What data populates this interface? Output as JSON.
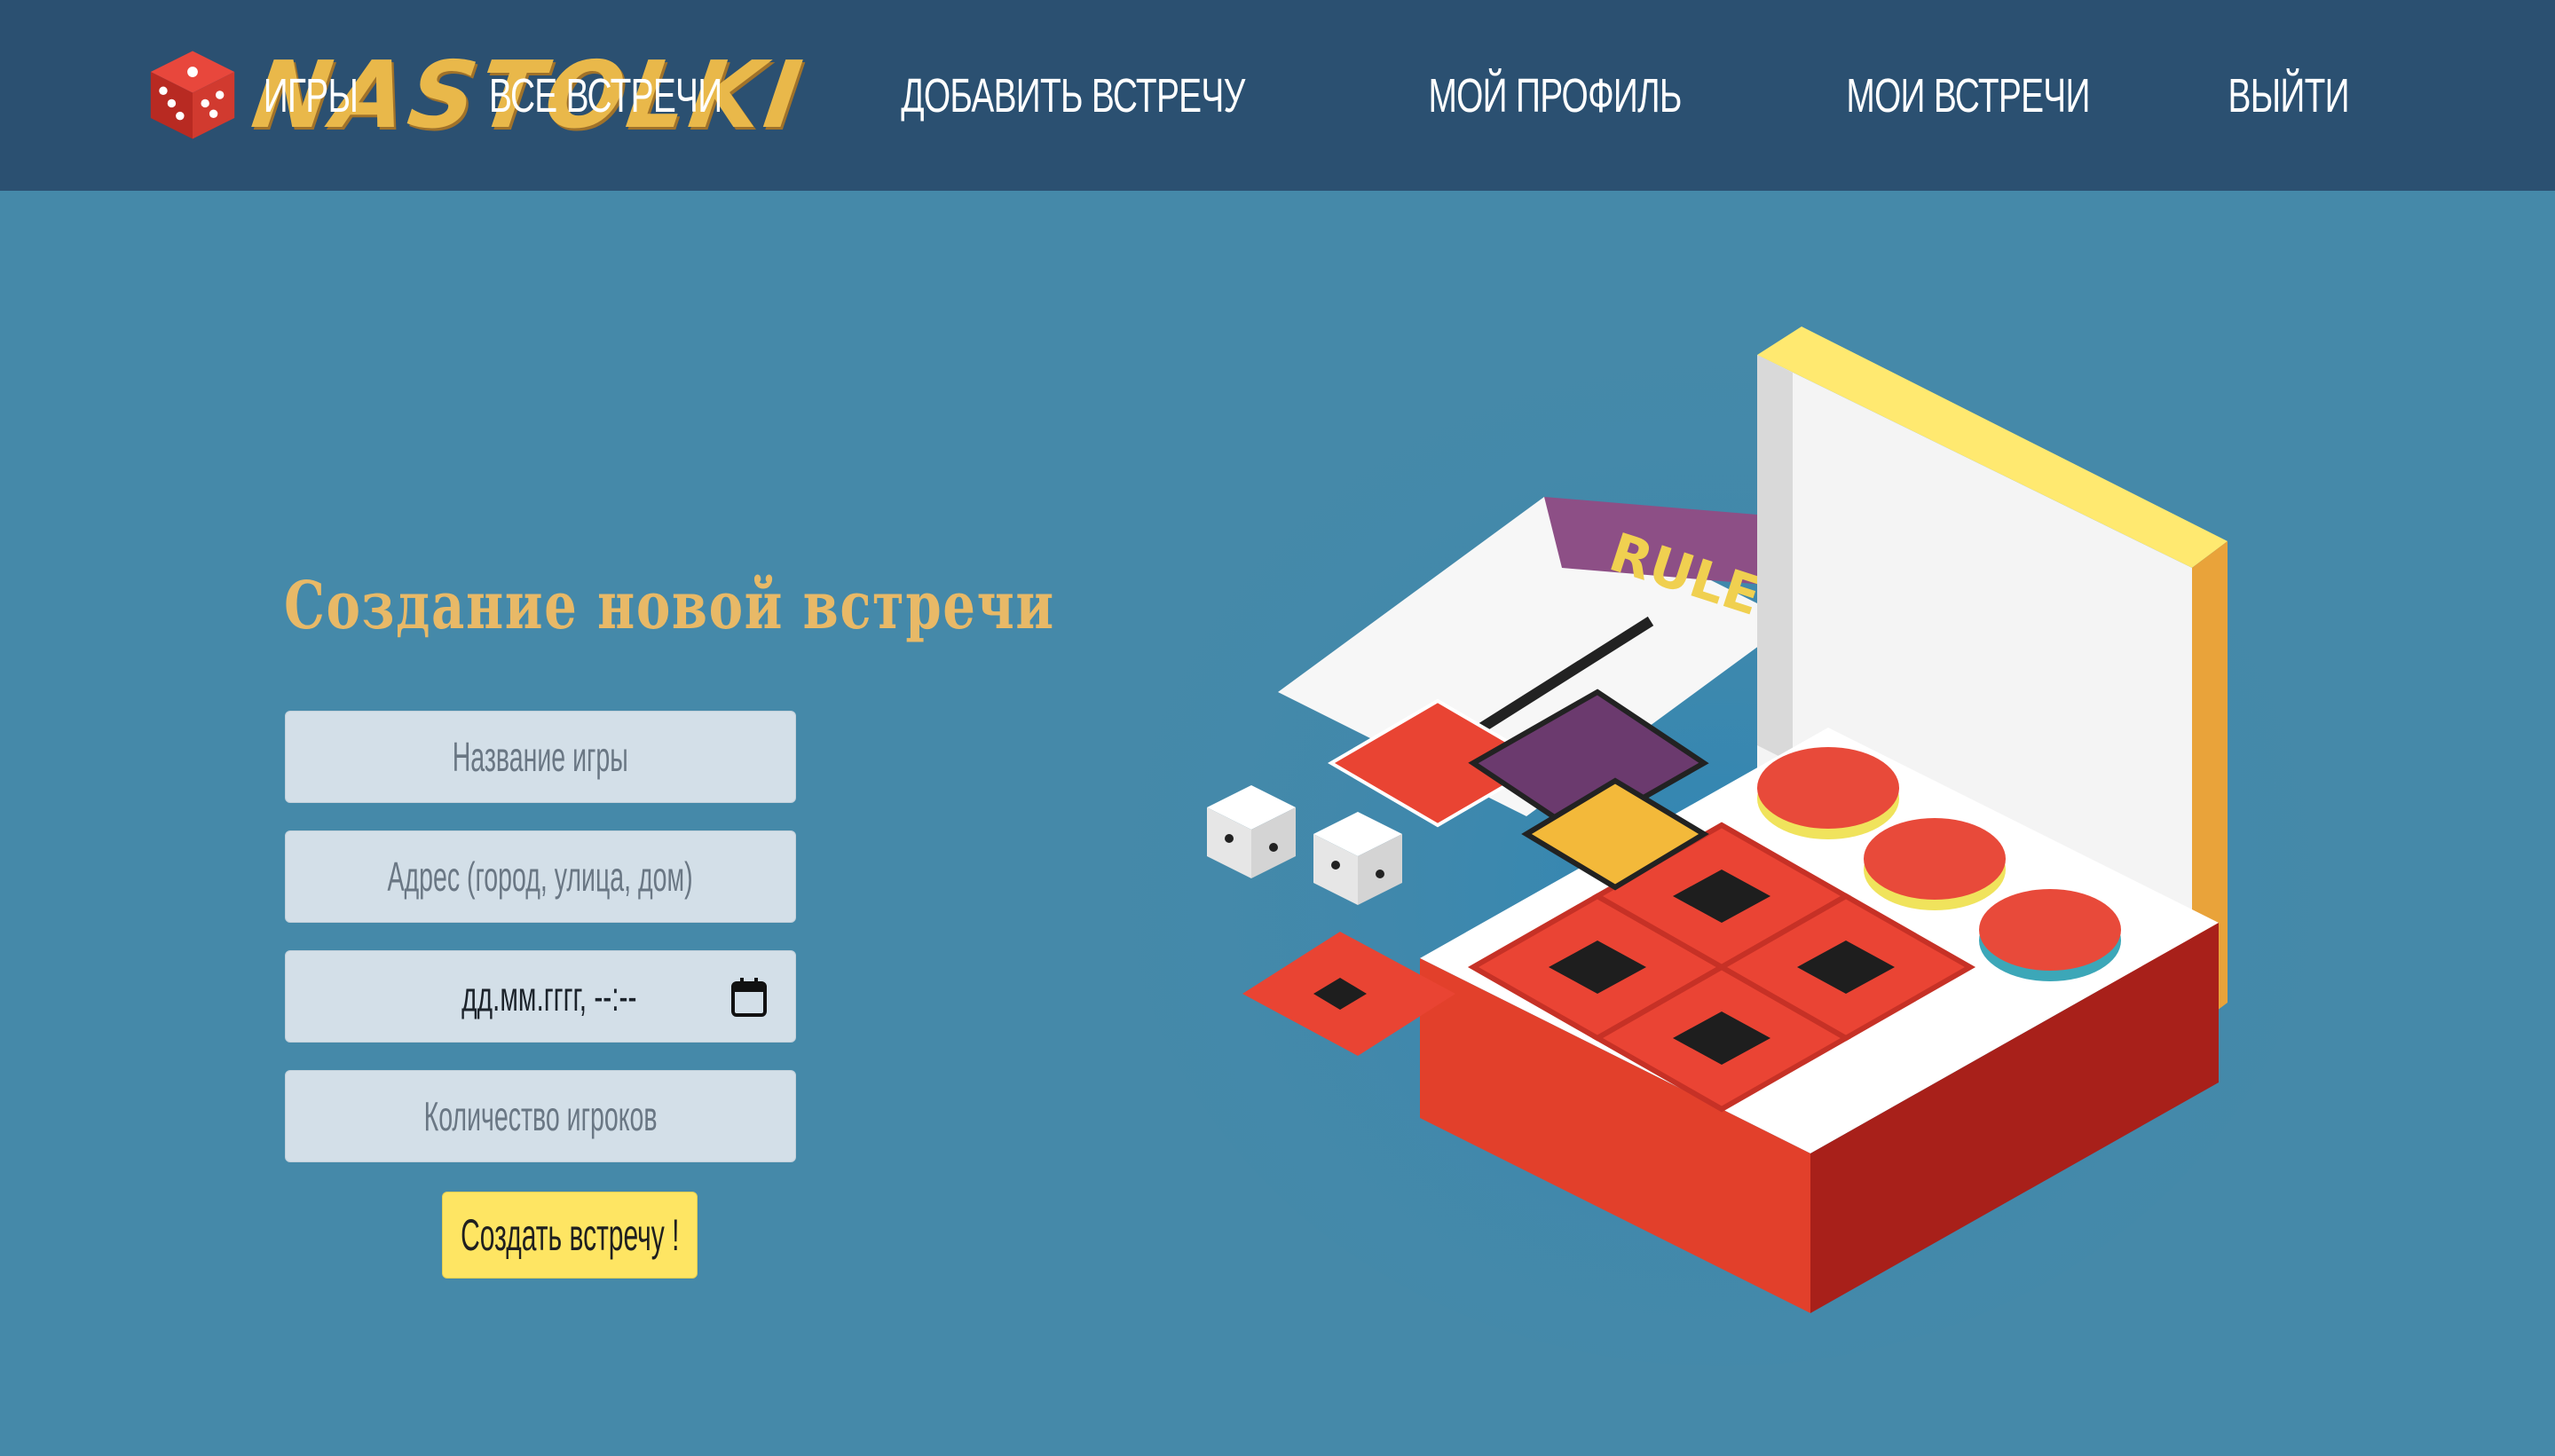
{
  "brand": {
    "name": "NASTOLKI",
    "icon": "dice-icon"
  },
  "nav": {
    "items": [
      {
        "label": "ИГРЫ"
      },
      {
        "label": "ВСЕ ВСТРЕЧИ"
      },
      {
        "label": "ДОБАВИТЬ ВСТРЕЧУ"
      },
      {
        "label": "МОЙ ПРОФИЛЬ"
      },
      {
        "label": "МОИ ВСТРЕЧИ"
      },
      {
        "label": "ВЫЙТИ"
      }
    ]
  },
  "form": {
    "title": "Создание новой встречи",
    "game_name_placeholder": "Название игры",
    "address_placeholder": "Адрес (город, улица, дом)",
    "datetime_value": "дд.мм.гггг, --:--",
    "players_placeholder": "Количество игроков",
    "submit_label": "Создать встречу !"
  },
  "illustration": {
    "rules_text": "RULE",
    "icon": "board-game-box-illustration"
  },
  "colors": {
    "header_bg": "#2b5071",
    "page_bg": "#4589a9",
    "accent_gold": "#e8b967",
    "button_yellow": "#fee563",
    "field_bg": "#d3dfe8"
  }
}
